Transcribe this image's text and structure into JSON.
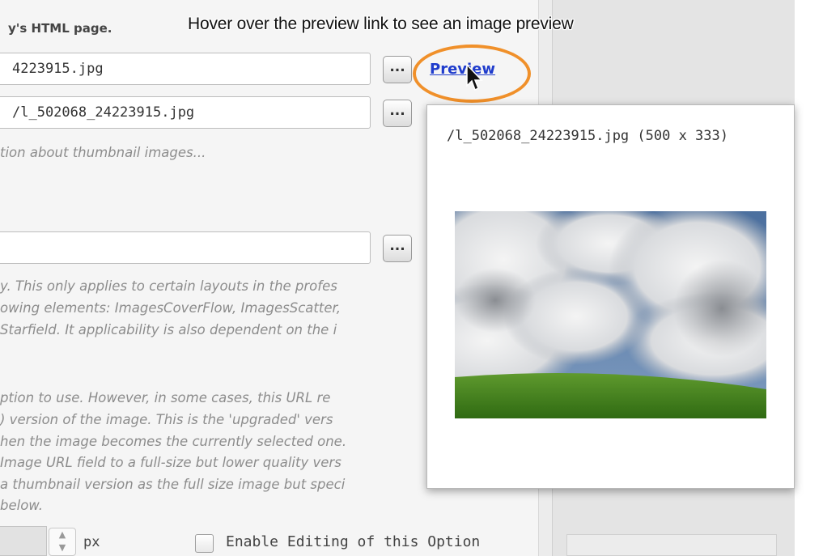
{
  "caption": "Hover over the preview link to see an image preview",
  "heading": "y's HTML page.",
  "image_url_field": {
    "value": "4223915.jpg"
  },
  "thumbnail_url_field": {
    "value": "/l_502068_24223915.jpg"
  },
  "browse_label": "...",
  "preview_link": "Preview",
  "thumbnail_help": "tion about thumbnail images...",
  "third_field": {
    "value": ""
  },
  "help_lines_1": [
    "y.  This only applies to certain layouts in the profes",
    "owing elements: ImagesCoverFlow, ImagesScatter,",
    "Starfield.  It applicability is also dependent on the i"
  ],
  "help_lines_2": [
    "ption to use.  However, in some cases, this URL re",
    ") version of the image.  This is the 'upgraded' vers",
    "hen the image becomes the currently selected one.",
    "Image URL field to a full-size but lower quality vers",
    "a thumbnail version as the full size image but speci",
    " below."
  ],
  "unit_label": "px",
  "editing_checkbox_label": "Enable Editing of this Option",
  "popup": {
    "title": "/l_502068_24223915.jpg (500 x 333)"
  },
  "colors": {
    "highlight": "#f0902a",
    "link": "#1f3ccc"
  }
}
